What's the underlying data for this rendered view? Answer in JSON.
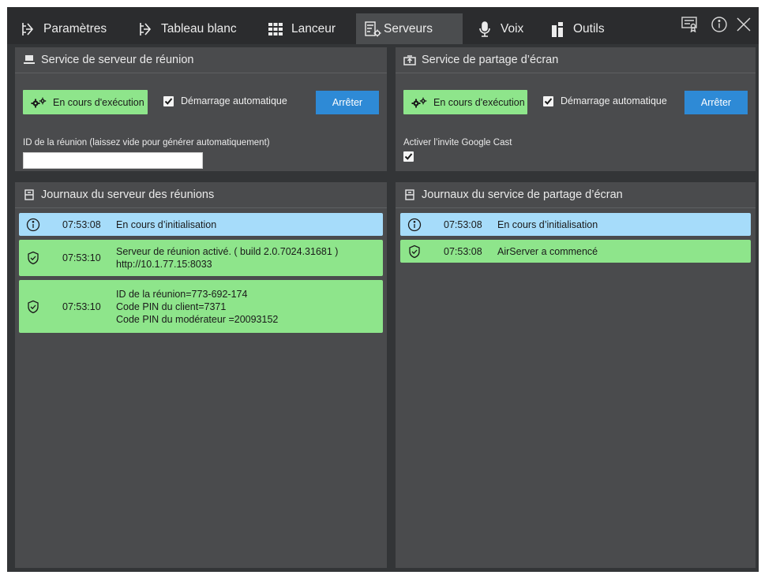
{
  "tabs": [
    {
      "label": "Paramètres",
      "icon": "settings-icon"
    },
    {
      "label": "Tableau blanc",
      "icon": "whiteboard-icon"
    },
    {
      "label": "Lanceur",
      "icon": "grid-icon"
    },
    {
      "label": "Serveurs",
      "icon": "server-settings-icon",
      "active": true
    },
    {
      "label": "Voix",
      "icon": "microphone-icon"
    },
    {
      "label": "Outils",
      "icon": "tools-icon"
    }
  ],
  "titlebar_icons": [
    "certificate-icon",
    "info-icon",
    "close-icon"
  ],
  "meeting_service": {
    "title": "Service de serveur de réunion",
    "status_label": "En cours d'exécution",
    "autostart_label": "Démarrage automatique",
    "autostart_checked": true,
    "stop_label": "Arrêter",
    "meeting_id_label": "ID de la réunion (laissez vide pour générer automatiquement)",
    "meeting_id_value": ""
  },
  "screen_share_service": {
    "title": "Service de partage d’écran",
    "status_label": "En cours d'exécution",
    "autostart_label": "Démarrage automatique",
    "autostart_checked": true,
    "stop_label": "Arrêter",
    "google_cast_label": "Activer l’invite Google Cast",
    "google_cast_checked": true
  },
  "meeting_logs": {
    "title": "Journaux du serveur des réunions",
    "entries": [
      {
        "type": "info",
        "time": "07:53:08",
        "lines": [
          "En cours d’initialisation"
        ]
      },
      {
        "type": "ok",
        "time": "07:53:10",
        "lines": [
          "Serveur de réunion activé.  ( build 2.0.7024.31681 )",
          "http://10.1.77.15:8033"
        ]
      },
      {
        "type": "ok",
        "time": "07:53:10",
        "lines": [
          "ID de la réunion=773-692-174",
          "Code PIN du client=7371",
          "Code PIN du modérateur =20093152"
        ]
      }
    ]
  },
  "screen_share_logs": {
    "title": "Journaux du service de partage d’écran",
    "entries": [
      {
        "type": "info",
        "time": "07:53:08",
        "lines": [
          "En cours d’initialisation"
        ]
      },
      {
        "type": "ok",
        "time": "07:53:08",
        "lines": [
          "AirServer a commencé"
        ]
      }
    ]
  },
  "colors": {
    "background": "#333537",
    "panel": "#4a4b4d",
    "status_green": "#8ee58b",
    "info_blue": "#a6dcfa",
    "stop_blue": "#2e8ad6"
  }
}
